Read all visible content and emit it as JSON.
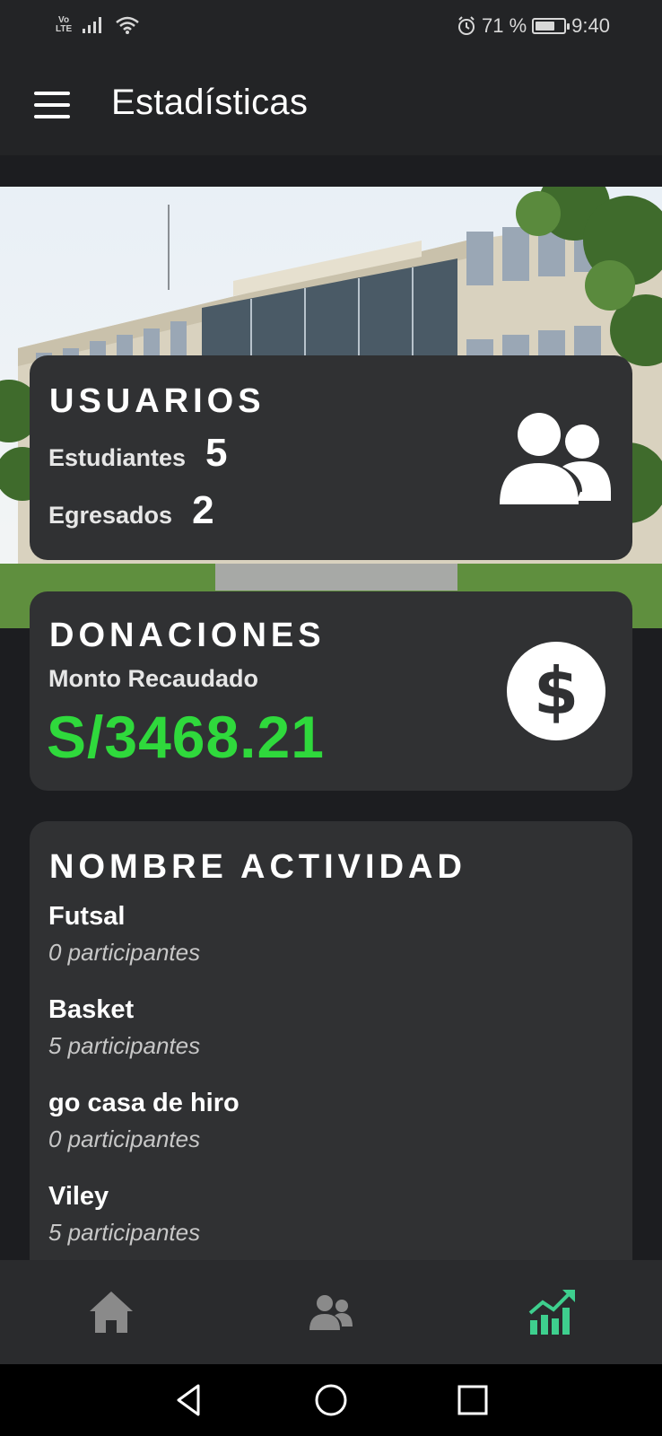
{
  "status_bar": {
    "network_label_top": "Vo",
    "network_label_bottom": "LTE",
    "battery_text": "71 %",
    "battery_level": 0.71,
    "time": "9:40"
  },
  "app_bar": {
    "title": "Estadísticas",
    "menu_icon": "hamburger-menu-icon"
  },
  "usuarios": {
    "title": "USUARIOS",
    "students_label": "Estudiantes",
    "students_value": "5",
    "graduates_label": "Egresados",
    "graduates_value": "2",
    "icon": "users-group-icon"
  },
  "donaciones": {
    "title": "DONACIONES",
    "label": "Monto Recaudado",
    "amount": "S/3468.21",
    "amount_color": "#2fd93c",
    "icon": "dollar-circle-icon"
  },
  "actividades": {
    "title": "NOMBRE ACTIVIDAD",
    "items": [
      {
        "name": "Futsal",
        "count": "0 participantes"
      },
      {
        "name": "Basket",
        "count": "5 participantes"
      },
      {
        "name": "go casa de hiro",
        "count": "0 participantes"
      },
      {
        "name": "Viley",
        "count": "5 participantes"
      }
    ]
  },
  "bottom_nav": {
    "items": [
      {
        "icon": "home-icon",
        "active": false
      },
      {
        "icon": "users-icon",
        "active": false
      },
      {
        "icon": "stats-chart-icon",
        "active": true
      }
    ],
    "active_color": "#3ecf8e",
    "inactive_color": "#8a8a8a"
  },
  "system_nav": {
    "items": [
      "back-icon",
      "home-circle-icon",
      "recents-square-icon"
    ]
  }
}
